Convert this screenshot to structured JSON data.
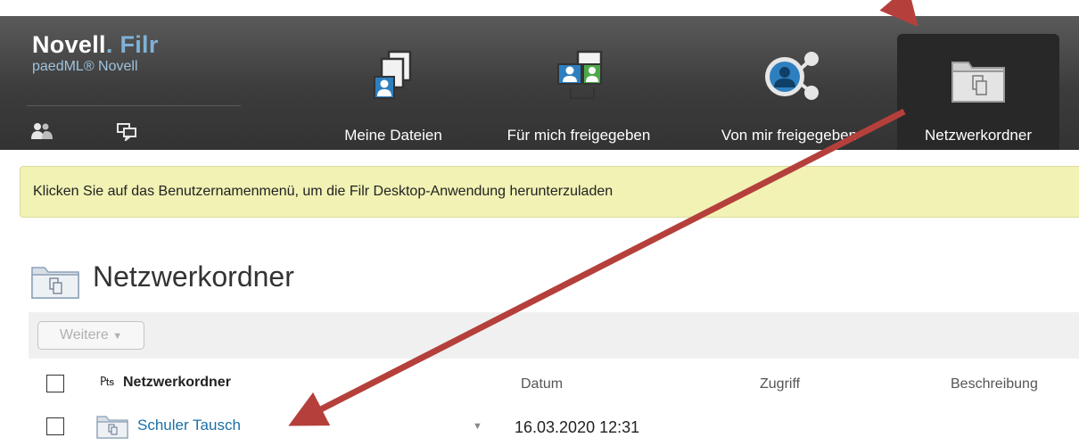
{
  "brand": {
    "name": "Novell",
    "dot": ".",
    "product": "Filr",
    "subtitle": "paedML® Novell"
  },
  "header_icons": [
    "people-icon",
    "chat-icon"
  ],
  "nav": {
    "tabs": [
      {
        "label": "Meine Dateien",
        "icon": "my-files-icon"
      },
      {
        "label": "Für mich freigegeben",
        "icon": "shared-with-me-icon"
      },
      {
        "label": "Von mir freigegeben",
        "icon": "shared-by-me-icon"
      },
      {
        "label": "Netzwerkordner",
        "icon": "network-folder-icon",
        "active": true
      }
    ]
  },
  "banner": {
    "text": "Klicken Sie auf das Benutzernamenmenü, um die Filr Desktop-Anwendung herunterzuladen"
  },
  "page": {
    "title": "Netzwerkordner"
  },
  "toolbar": {
    "weitere_label": "Weitere"
  },
  "table": {
    "columns": {
      "name": "Netzwerkordner",
      "datum": "Datum",
      "zugriff": "Zugriff",
      "beschreibung": "Beschreibung"
    },
    "rows": [
      {
        "name": "Schuler Tausch",
        "date": "16.03.2020 12:31"
      }
    ]
  },
  "colors": {
    "header_dark": "#333333",
    "banner_yellow": "#f1f2b4",
    "link_blue": "#1a6fa8",
    "annotation_red": "#b5403b"
  }
}
